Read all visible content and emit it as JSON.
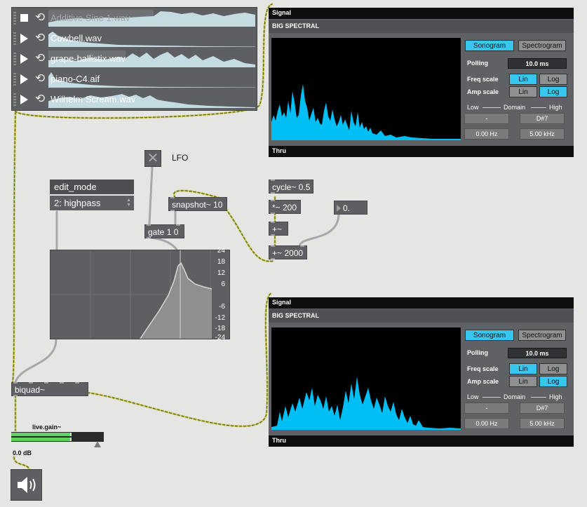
{
  "playlist": {
    "items": [
      {
        "name": "Additive Sine 1.wav",
        "state": "stop"
      },
      {
        "name": "Cowbell.wav",
        "state": "play"
      },
      {
        "name": "grape-ballistix.wav",
        "state": "play"
      },
      {
        "name": "piano-C4.aif",
        "state": "play"
      },
      {
        "name": "Wilhelm Scream.wav",
        "state": "play"
      }
    ]
  },
  "spectral_top": {
    "signal_label": "Signal",
    "title": "BIG SPECTRAL",
    "thru_label": "Thru",
    "sonogram_label": "Sonogram",
    "spectrogram_label": "Spectrogram",
    "polling_label": "Polling",
    "polling_value": "10.0 ms",
    "freq_scale_label": "Freq scale",
    "amp_scale_label": "Amp scale",
    "lin_label": "Lin",
    "log_label": "Log",
    "low_label": "Low",
    "domain_label": "Domain",
    "high_label": "High",
    "low_note": "-",
    "high_note": "D#7",
    "low_freq": "0.00 Hz",
    "high_freq": "5.00 kHz"
  },
  "spectral_bottom": {
    "signal_label": "Signal",
    "title": "BIG SPECTRAL",
    "thru_label": "Thru",
    "sonogram_label": "Sonogram",
    "spectrogram_label": "Spectrogram",
    "polling_label": "Polling",
    "polling_value": "10.0 ms",
    "freq_scale_label": "Freq scale",
    "amp_scale_label": "Amp scale",
    "lin_label": "Lin",
    "log_label": "Log",
    "low_label": "Low",
    "domain_label": "Domain",
    "high_label": "High",
    "low_note": "-",
    "high_note": "D#7",
    "low_freq": "0.00 Hz",
    "high_freq": "5.00 kHz"
  },
  "objects": {
    "lfo_label": "LFO",
    "gate": "gate 1 0",
    "snapshot": "snapshot~ 10",
    "cycle": "cycle~ 0.5",
    "mul": "*~ 200",
    "plus": "+~",
    "plus2000": "+~ 2000",
    "number": "0.",
    "biquad": "biquad~"
  },
  "umenu": {
    "attr": "edit_mode",
    "value": "2: highpass"
  },
  "filtergraph": {
    "ticks": [
      "24",
      "18",
      "12",
      "6",
      "-6",
      "-12",
      "-18",
      "-24"
    ]
  },
  "live_gain": {
    "label": "live.gain~",
    "value": "0.0 dB"
  },
  "colors": {
    "accent": "#36c6ee",
    "spectrum": "#00bff5",
    "cord_signal": "#4f6e1d"
  },
  "icons": {
    "toggle": "x-icon",
    "dac": "speaker-icon"
  }
}
